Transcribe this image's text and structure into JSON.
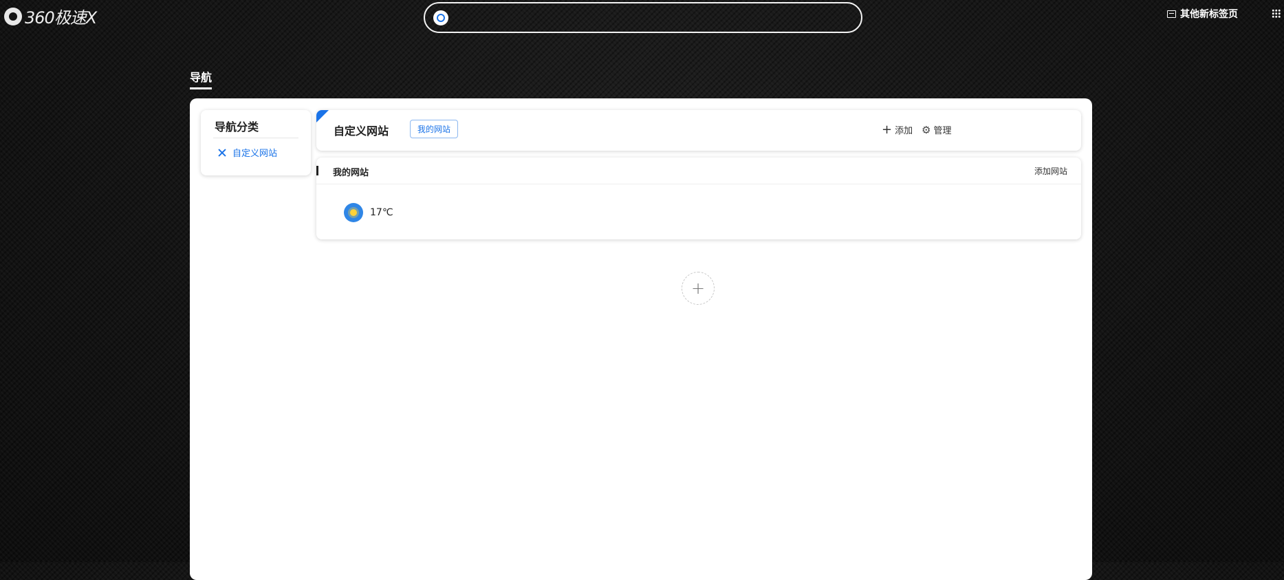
{
  "topbar": {
    "logo_text": "360极速X",
    "search": {
      "placeholder": ""
    },
    "other_tabs_label": "其他新标签页"
  },
  "nav": {
    "title": "导航"
  },
  "sidebar": {
    "title": "导航分类",
    "items": [
      {
        "label": "自定义网站",
        "icon": "pen-icon"
      }
    ]
  },
  "header": {
    "title": "自定义网站",
    "tag": "我的网站",
    "add_label": "添加",
    "manage_label": "管理"
  },
  "section": {
    "title": "我的网站",
    "link": "添加网站",
    "weather": {
      "temperature": "17℃",
      "icon": "sun-icon"
    }
  },
  "add_section": {
    "glyph": "+"
  },
  "colors": {
    "accent": "#1a73e8",
    "background": "#151515",
    "panel": "#ffffff"
  }
}
